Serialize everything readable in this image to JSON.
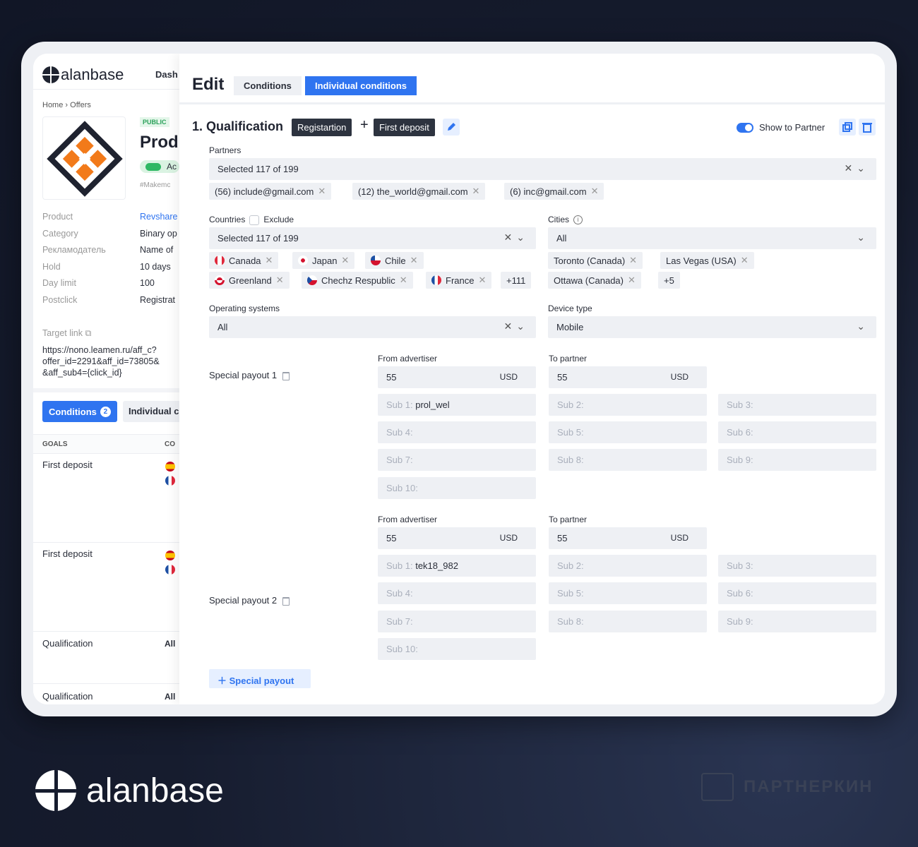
{
  "left": {
    "logo_text": "alanbase",
    "dash": "Dash",
    "breadcrumb_home": "Home",
    "breadcrumb_offers": "Offers",
    "public_badge": "PUBLIC",
    "product_title": "Prod",
    "toggle_label": "Ac",
    "tag": "#Makemc",
    "fields": [
      {
        "k": "Product",
        "v": "Revshare"
      },
      {
        "k": "Category",
        "v": "Binary op"
      },
      {
        "k": "Рекламодатель",
        "v": "Name of"
      },
      {
        "k": "Hold",
        "v": "10 days"
      },
      {
        "k": "Day limit",
        "v": "100"
      },
      {
        "k": "Postclick",
        "v": "Registrat"
      }
    ],
    "target_link_label": "Target link",
    "target_url": "https://nono.leamen.ru/aff_c?\noffer_id=2291&aff_id=73805&\n&aff_sub4={click_id}",
    "conditions_tab": "Conditions",
    "conditions_count": "2",
    "individual_tab": "Individual c",
    "col_goals": "GOALS",
    "col_co": "CO",
    "rows": [
      {
        "goal": "First deposit",
        "right": ""
      },
      {
        "goal": "First deposit",
        "right": ""
      },
      {
        "goal": "Qualification",
        "right": "All"
      },
      {
        "goal": "Qualification",
        "right": "All"
      }
    ]
  },
  "editor": {
    "title": "Edit",
    "tab_conditions": "Conditions",
    "tab_individual": "Individual conditions",
    "section_title": "1.  Qualification",
    "chip_registration": "Registartion",
    "plus": "+",
    "chip_first_deposit": "First deposit",
    "show_to_partner": "Show to Partner",
    "partners_label": "Partners",
    "partners_value": "Selected 117 of 199",
    "partner_chips": [
      "(56) include@gmail.com",
      "(12) the_world@gmail.com",
      "(6) inc@gmail.com"
    ],
    "countries_label": "Countries",
    "exclude_label": "Exclude",
    "countries_value": "Selected 117 of 199",
    "country_chips": [
      "Canada",
      "Japan",
      "Chile",
      "Greenland",
      "Chechz Respublic",
      "France"
    ],
    "country_more": "+111",
    "cities_label": "Cities",
    "cities_value": "All",
    "city_chips": [
      "Toronto (Canada)",
      "Las Vegas (USA)",
      "Ottawa (Canada)"
    ],
    "city_more": "+5",
    "os_label": "Operating systems",
    "os_value": "All",
    "device_label": "Device type",
    "device_value": "Mobile",
    "from_advertiser": "From advertiser",
    "to_partner": "To partner",
    "currency": "USD",
    "payouts": [
      {
        "label": "Special payout 1",
        "from_value": "55",
        "to_value": "55",
        "subs": [
          {
            "ph": "Sub 1:",
            "val": "prol_wel"
          },
          {
            "ph": "Sub 2:",
            "val": ""
          },
          {
            "ph": "Sub 3:",
            "val": ""
          },
          {
            "ph": "Sub 4:",
            "val": ""
          },
          {
            "ph": "Sub 5:",
            "val": ""
          },
          {
            "ph": "Sub 6:",
            "val": ""
          },
          {
            "ph": "Sub 7:",
            "val": ""
          },
          {
            "ph": "Sub 8:",
            "val": ""
          },
          {
            "ph": "Sub 9:",
            "val": ""
          },
          {
            "ph": "Sub 10:",
            "val": ""
          }
        ]
      },
      {
        "label": "Special payout 2",
        "from_value": "55",
        "to_value": "55",
        "subs": [
          {
            "ph": "Sub 1:",
            "val": "tek18_982"
          },
          {
            "ph": "Sub 2:",
            "val": ""
          },
          {
            "ph": "Sub 3:",
            "val": ""
          },
          {
            "ph": "Sub 4:",
            "val": ""
          },
          {
            "ph": "Sub 5:",
            "val": ""
          },
          {
            "ph": "Sub 6:",
            "val": ""
          },
          {
            "ph": "Sub 7:",
            "val": ""
          },
          {
            "ph": "Sub 8:",
            "val": ""
          },
          {
            "ph": "Sub 9:",
            "val": ""
          },
          {
            "ph": "Sub 10:",
            "val": ""
          }
        ]
      }
    ],
    "add_special_payout": "Special payout"
  },
  "brand": {
    "logo_text": "alanbase",
    "watermark": "ПАРТНЕРКИН"
  },
  "colors": {
    "accent": "#2f74f0",
    "dark_chip": "#2d333f",
    "field_bg": "#eef0f4",
    "page_bg": "#161c2e"
  }
}
